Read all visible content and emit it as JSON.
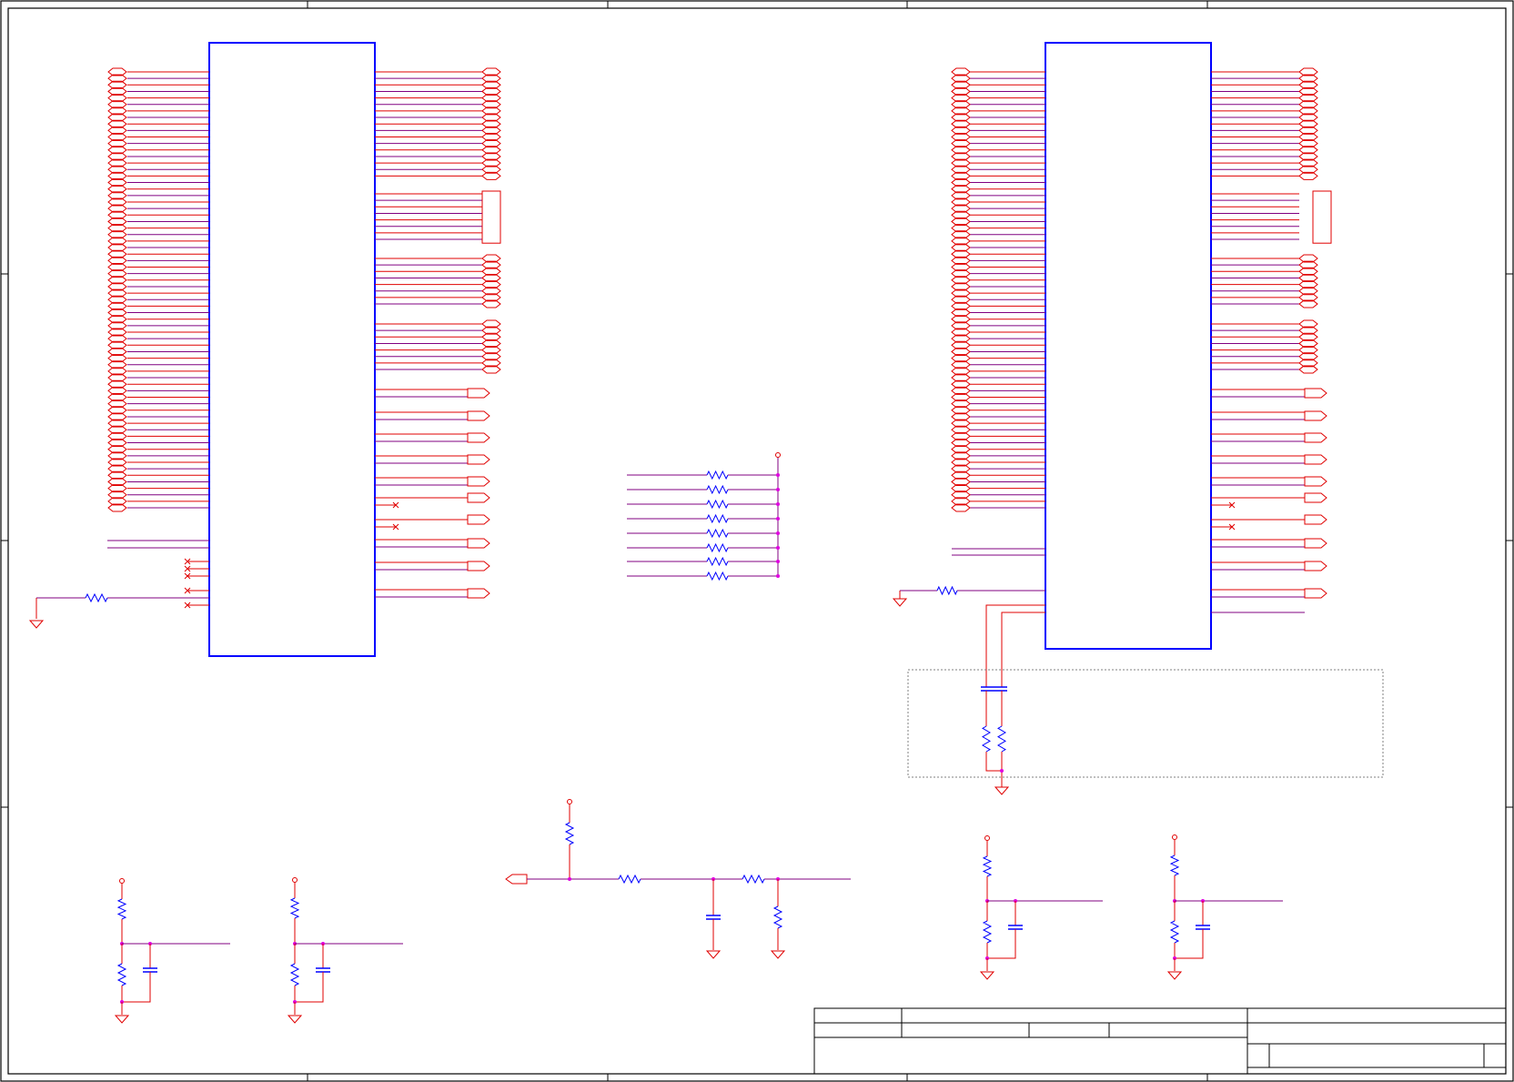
{
  "schematic": {
    "components": {
      "ic_u1": "ic-block",
      "ic_u2": "ic-block",
      "resistor_network": "resistor-array",
      "filter_circuit": "rc-filter",
      "bias_dividers": "voltage-divider"
    }
  },
  "colors": {
    "wire": "#e00000",
    "net": "#800080",
    "component": "#0000ff",
    "junction": "#e000e0",
    "frame": "#000000"
  },
  "icons": {
    "ground": "ground-icon",
    "power": "power-flag-icon",
    "port": "port-connector-icon",
    "no_connect": "no-connect-icon"
  }
}
